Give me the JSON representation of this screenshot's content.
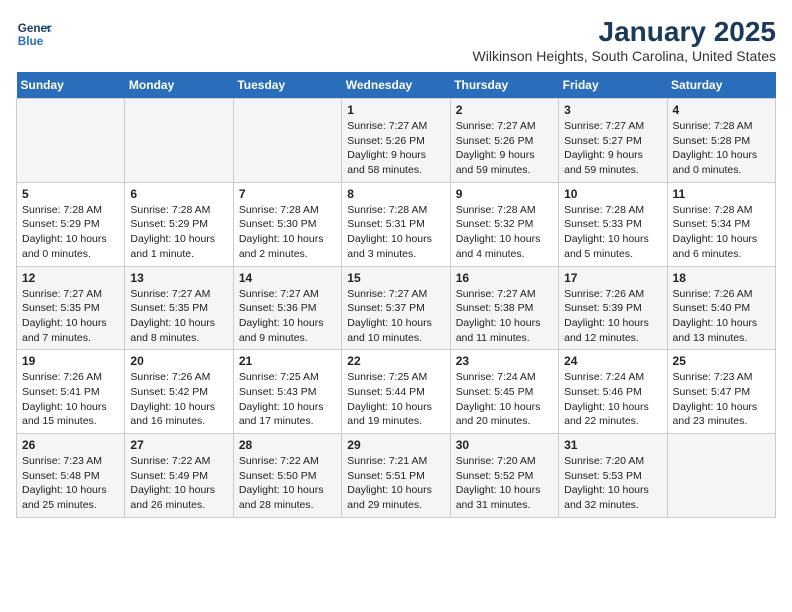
{
  "header": {
    "logo_line1": "General",
    "logo_line2": "Blue",
    "title": "January 2025",
    "subtitle": "Wilkinson Heights, South Carolina, United States"
  },
  "weekdays": [
    "Sunday",
    "Monday",
    "Tuesday",
    "Wednesday",
    "Thursday",
    "Friday",
    "Saturday"
  ],
  "weeks": [
    [
      {
        "day": "",
        "info": ""
      },
      {
        "day": "",
        "info": ""
      },
      {
        "day": "",
        "info": ""
      },
      {
        "day": "1",
        "info": "Sunrise: 7:27 AM\nSunset: 5:26 PM\nDaylight: 9 hours\nand 58 minutes."
      },
      {
        "day": "2",
        "info": "Sunrise: 7:27 AM\nSunset: 5:26 PM\nDaylight: 9 hours\nand 59 minutes."
      },
      {
        "day": "3",
        "info": "Sunrise: 7:27 AM\nSunset: 5:27 PM\nDaylight: 9 hours\nand 59 minutes."
      },
      {
        "day": "4",
        "info": "Sunrise: 7:28 AM\nSunset: 5:28 PM\nDaylight: 10 hours\nand 0 minutes."
      }
    ],
    [
      {
        "day": "5",
        "info": "Sunrise: 7:28 AM\nSunset: 5:29 PM\nDaylight: 10 hours\nand 0 minutes."
      },
      {
        "day": "6",
        "info": "Sunrise: 7:28 AM\nSunset: 5:29 PM\nDaylight: 10 hours\nand 1 minute."
      },
      {
        "day": "7",
        "info": "Sunrise: 7:28 AM\nSunset: 5:30 PM\nDaylight: 10 hours\nand 2 minutes."
      },
      {
        "day": "8",
        "info": "Sunrise: 7:28 AM\nSunset: 5:31 PM\nDaylight: 10 hours\nand 3 minutes."
      },
      {
        "day": "9",
        "info": "Sunrise: 7:28 AM\nSunset: 5:32 PM\nDaylight: 10 hours\nand 4 minutes."
      },
      {
        "day": "10",
        "info": "Sunrise: 7:28 AM\nSunset: 5:33 PM\nDaylight: 10 hours\nand 5 minutes."
      },
      {
        "day": "11",
        "info": "Sunrise: 7:28 AM\nSunset: 5:34 PM\nDaylight: 10 hours\nand 6 minutes."
      }
    ],
    [
      {
        "day": "12",
        "info": "Sunrise: 7:27 AM\nSunset: 5:35 PM\nDaylight: 10 hours\nand 7 minutes."
      },
      {
        "day": "13",
        "info": "Sunrise: 7:27 AM\nSunset: 5:35 PM\nDaylight: 10 hours\nand 8 minutes."
      },
      {
        "day": "14",
        "info": "Sunrise: 7:27 AM\nSunset: 5:36 PM\nDaylight: 10 hours\nand 9 minutes."
      },
      {
        "day": "15",
        "info": "Sunrise: 7:27 AM\nSunset: 5:37 PM\nDaylight: 10 hours\nand 10 minutes."
      },
      {
        "day": "16",
        "info": "Sunrise: 7:27 AM\nSunset: 5:38 PM\nDaylight: 10 hours\nand 11 minutes."
      },
      {
        "day": "17",
        "info": "Sunrise: 7:26 AM\nSunset: 5:39 PM\nDaylight: 10 hours\nand 12 minutes."
      },
      {
        "day": "18",
        "info": "Sunrise: 7:26 AM\nSunset: 5:40 PM\nDaylight: 10 hours\nand 13 minutes."
      }
    ],
    [
      {
        "day": "19",
        "info": "Sunrise: 7:26 AM\nSunset: 5:41 PM\nDaylight: 10 hours\nand 15 minutes."
      },
      {
        "day": "20",
        "info": "Sunrise: 7:26 AM\nSunset: 5:42 PM\nDaylight: 10 hours\nand 16 minutes."
      },
      {
        "day": "21",
        "info": "Sunrise: 7:25 AM\nSunset: 5:43 PM\nDaylight: 10 hours\nand 17 minutes."
      },
      {
        "day": "22",
        "info": "Sunrise: 7:25 AM\nSunset: 5:44 PM\nDaylight: 10 hours\nand 19 minutes."
      },
      {
        "day": "23",
        "info": "Sunrise: 7:24 AM\nSunset: 5:45 PM\nDaylight: 10 hours\nand 20 minutes."
      },
      {
        "day": "24",
        "info": "Sunrise: 7:24 AM\nSunset: 5:46 PM\nDaylight: 10 hours\nand 22 minutes."
      },
      {
        "day": "25",
        "info": "Sunrise: 7:23 AM\nSunset: 5:47 PM\nDaylight: 10 hours\nand 23 minutes."
      }
    ],
    [
      {
        "day": "26",
        "info": "Sunrise: 7:23 AM\nSunset: 5:48 PM\nDaylight: 10 hours\nand 25 minutes."
      },
      {
        "day": "27",
        "info": "Sunrise: 7:22 AM\nSunset: 5:49 PM\nDaylight: 10 hours\nand 26 minutes."
      },
      {
        "day": "28",
        "info": "Sunrise: 7:22 AM\nSunset: 5:50 PM\nDaylight: 10 hours\nand 28 minutes."
      },
      {
        "day": "29",
        "info": "Sunrise: 7:21 AM\nSunset: 5:51 PM\nDaylight: 10 hours\nand 29 minutes."
      },
      {
        "day": "30",
        "info": "Sunrise: 7:20 AM\nSunset: 5:52 PM\nDaylight: 10 hours\nand 31 minutes."
      },
      {
        "day": "31",
        "info": "Sunrise: 7:20 AM\nSunset: 5:53 PM\nDaylight: 10 hours\nand 32 minutes."
      },
      {
        "day": "",
        "info": ""
      }
    ]
  ]
}
